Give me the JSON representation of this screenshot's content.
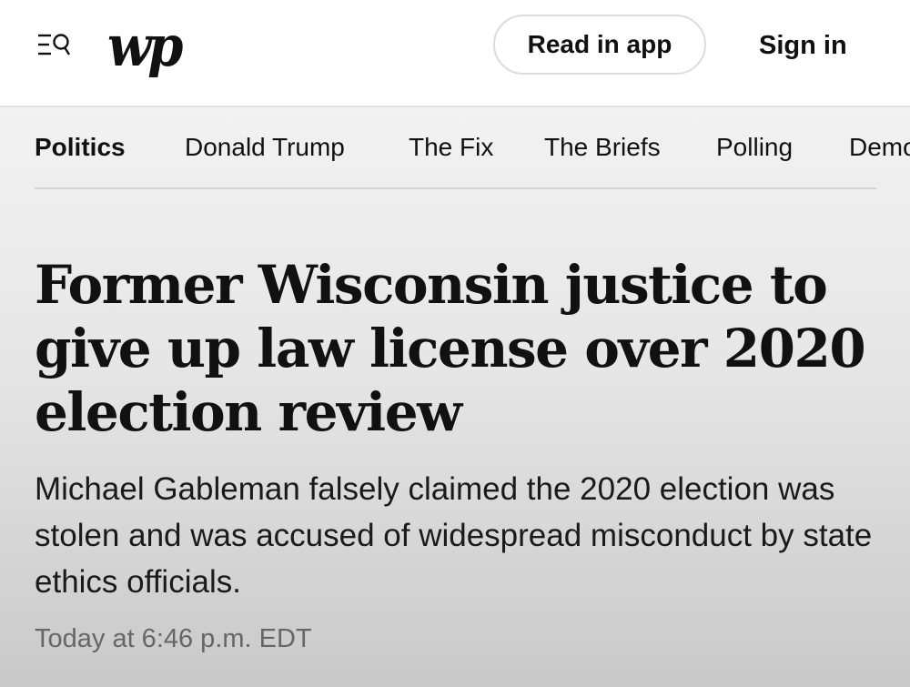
{
  "header": {
    "logo_text": "wp",
    "read_in_app_label": "Read in app",
    "sign_in_label": "Sign in"
  },
  "section_nav": {
    "items": [
      {
        "label": "Politics",
        "active": true
      },
      {
        "label": "Donald Trump"
      },
      {
        "label": "The Fix"
      },
      {
        "label": "The Briefs"
      },
      {
        "label": "Polling"
      },
      {
        "label": "Democracy"
      }
    ]
  },
  "article": {
    "headline": "Former Wisconsin justice to give up law license over 2020 election review",
    "dek": "Michael Gableman falsely claimed the 2020 election was stolen and was accused of widespread misconduct by state ethics officials.",
    "timestamp": "Today at 6:46 p.m. EDT"
  },
  "icons": {
    "menu": "menu-search-icon"
  },
  "colors": {
    "text": "#111111",
    "timestamp": "#666666",
    "divider": "#d4d4d4"
  }
}
